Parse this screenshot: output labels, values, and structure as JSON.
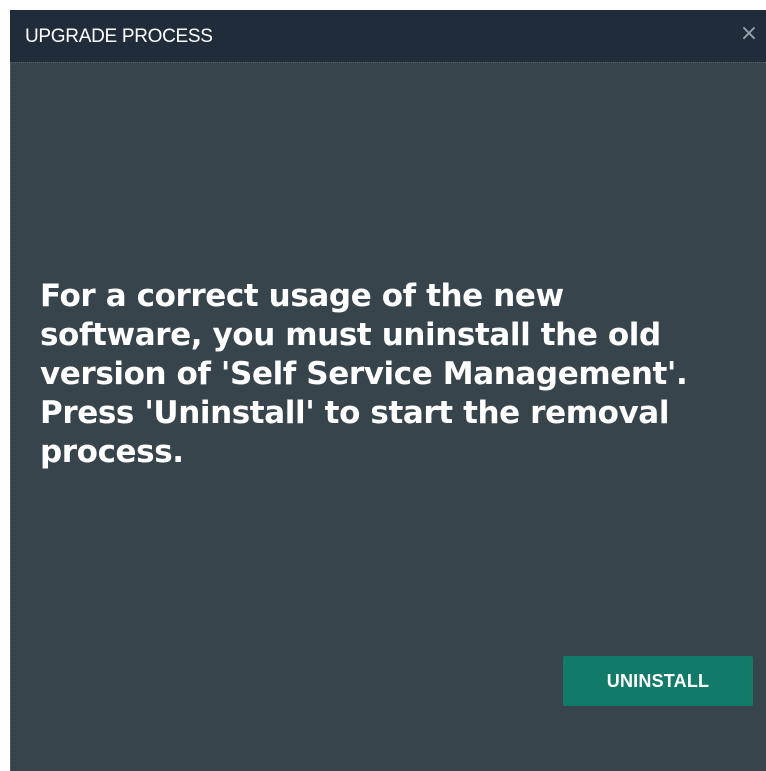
{
  "dialog": {
    "title": "UPGRADE PROCESS",
    "close_glyph": "×",
    "close_icon": "close-icon",
    "message_lines": [
      "For a correct usage of the new",
      "software, you must uninstall the old",
      "version of 'Self Service Management'.",
      "Press 'Uninstall' to start the removal",
      "process."
    ],
    "primary_button_label": "UNINSTALL"
  },
  "colors": {
    "titlebar": "#212c3a",
    "body": "#37444c",
    "button": "#127a68",
    "text": "#ffffff"
  }
}
